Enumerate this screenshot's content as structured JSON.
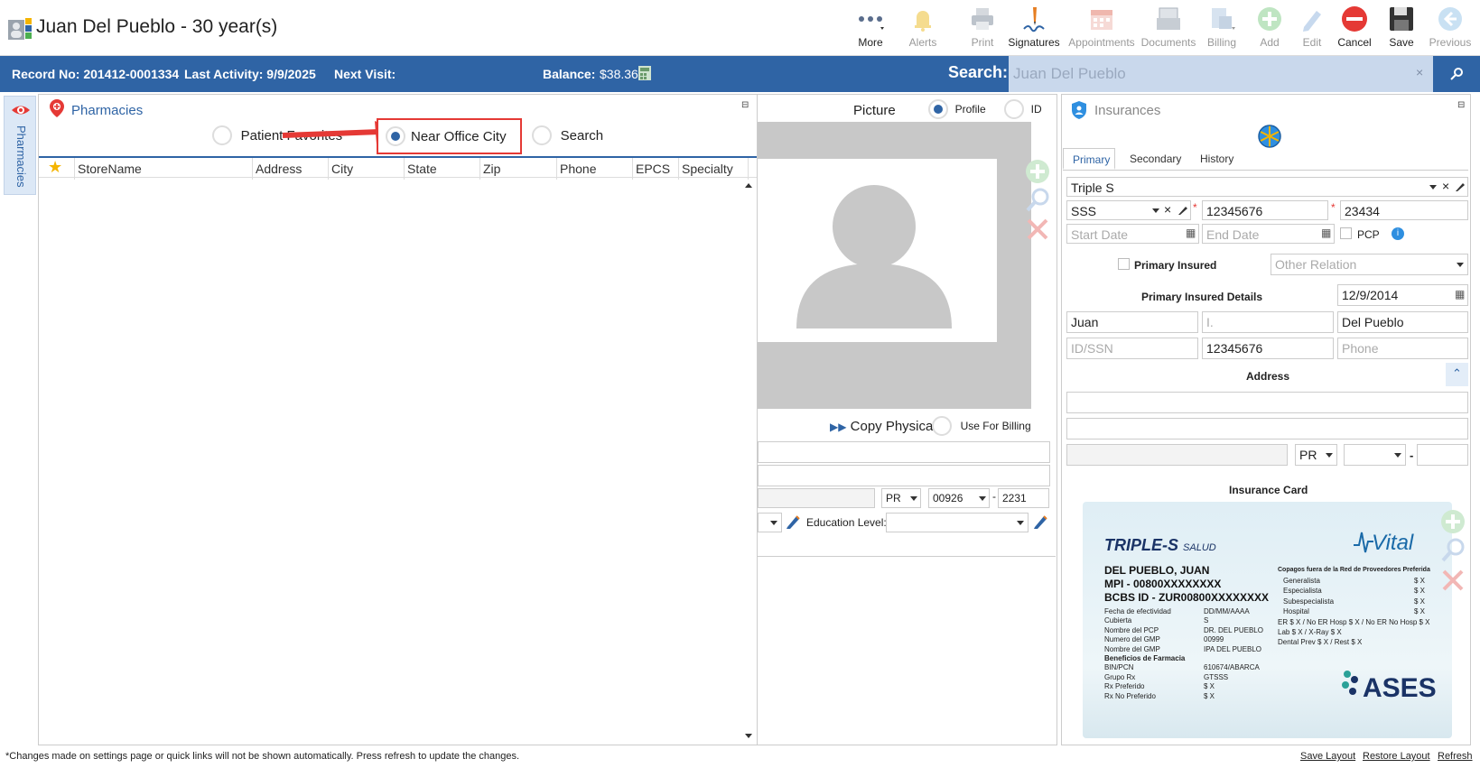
{
  "window": {
    "patient_title": "Juan Del Pueblo - 30 year(s)"
  },
  "toolbar": [
    {
      "label": "More",
      "icon": "more-icon",
      "enabled": true
    },
    {
      "label": "Alerts",
      "icon": "bell-icon",
      "enabled": false
    },
    {
      "label": "Print",
      "icon": "printer-icon",
      "enabled": false
    },
    {
      "label": "Signatures",
      "icon": "signature-icon",
      "enabled": true
    },
    {
      "label": "Appointments",
      "icon": "calendar-icon",
      "enabled": false
    },
    {
      "label": "Documents",
      "icon": "documents-icon",
      "enabled": false
    },
    {
      "label": "Billing",
      "icon": "billing-icon",
      "enabled": false
    },
    {
      "label": "Add",
      "icon": "add-icon",
      "enabled": false
    },
    {
      "label": "Edit",
      "icon": "pencil-icon",
      "enabled": false
    },
    {
      "label": "Cancel",
      "icon": "cancel-icon",
      "enabled": true
    },
    {
      "label": "Save",
      "icon": "save-icon",
      "enabled": true
    },
    {
      "label": "Previous",
      "icon": "previous-icon",
      "enabled": false
    }
  ],
  "infobar": {
    "record": "Record No: 201412-0001334",
    "last_activity": "Last Activity: 9/9/2025",
    "next_visit": "Next Visit:",
    "balance_label": "Balance:",
    "balance_value": "$38.36",
    "search_label": "Search:",
    "search_value": "Juan Del Pueblo"
  },
  "side_tab": {
    "label": "Pharmacies"
  },
  "pharmacies": {
    "title": "Pharmacies",
    "radios": [
      {
        "label": "Patient Favorites",
        "selected": false
      },
      {
        "label": "Near Office City",
        "selected": true
      },
      {
        "label": "Search",
        "selected": false
      }
    ],
    "columns": [
      "StoreName",
      "Address",
      "City",
      "State",
      "Zip",
      "Phone",
      "EPCS",
      "Specialty"
    ]
  },
  "picture": {
    "label": "Picture",
    "profile_label": "Profile",
    "id_label": "ID",
    "copy_physical": "Copy Physical",
    "use_for_billing": "Use For Billing",
    "state": "PR",
    "zip": "00926",
    "zip_ext": "2231",
    "education_label": "Education Level:"
  },
  "insurances": {
    "title": "Insurances",
    "tabs": [
      "Primary",
      "Secondary",
      "History"
    ],
    "active_tab": "Primary",
    "plan": "Triple S",
    "plan_code": "SSS",
    "member_id": "12345676",
    "group": "23434",
    "start_date_ph": "Start Date",
    "end_date_ph": "End Date",
    "pcp_label": "PCP",
    "primary_insured_label": "Primary Insured",
    "other_relation_ph": "Other Relation",
    "details_label": "Primary Insured Details",
    "dob": "12/9/2014",
    "first_name": "Juan",
    "middle_ph": "I.",
    "last_name": "Del Pueblo",
    "idssn_ph": "ID/SSN",
    "idssn_value": "12345676",
    "phone_ph": "Phone",
    "address_label": "Address",
    "state": "PR",
    "card_label": "Insurance Card",
    "card": {
      "brand": "TRIPLE-S",
      "brand_sub": "SALUD",
      "vital": "Vital",
      "name": "DEL PUEBLO, JUAN",
      "mpi": "MPI - 00800XXXXXXXX",
      "bcbs": "BCBS ID - ZUR00800XXXXXXXX",
      "left_lines": [
        [
          "Fecha de efectividad",
          "DD/MM/AAAA"
        ],
        [
          "Cubierta",
          "S"
        ],
        [
          "Nombre del PCP",
          "DR. DEL PUEBLO"
        ],
        [
          "Numero del GMP",
          "00999"
        ],
        [
          "Nombre del GMP",
          "IPA DEL PUEBLO"
        ],
        [
          "Beneficios de Farmacia",
          ""
        ],
        [
          "BIN/PCN",
          "610674/ABARCA"
        ],
        [
          "Grupo Rx",
          "GTSSS"
        ],
        [
          "Rx Preferido",
          "$ X"
        ],
        [
          "Rx No Preferido",
          "$ X"
        ]
      ],
      "right_title": "Copagos fuera de la Red de Proveedores Preferida",
      "right_lines": [
        [
          "Generalista",
          "$ X"
        ],
        [
          "Especialista",
          "$ X"
        ],
        [
          "Subespecialista",
          "$ X"
        ],
        [
          "Hospital",
          "$ X"
        ],
        [
          "ER $ X / No ER Hosp $ X / No ER No Hosp $ X",
          ""
        ],
        [
          "Lab $ X / X-Ray $ X",
          ""
        ],
        [
          "Dental Prev $ X / Rest $ X",
          ""
        ]
      ],
      "ases": "ASES"
    }
  },
  "footer": {
    "note": "*Changes made on settings page or quick links will not be shown automatically. Press refresh to update the changes.",
    "save_layout": "Save Layout",
    "restore_layout": "Restore Layout",
    "refresh": "Refresh"
  },
  "colors": {
    "brand_blue": "#2f64a5",
    "highlight_red": "#e53935"
  }
}
